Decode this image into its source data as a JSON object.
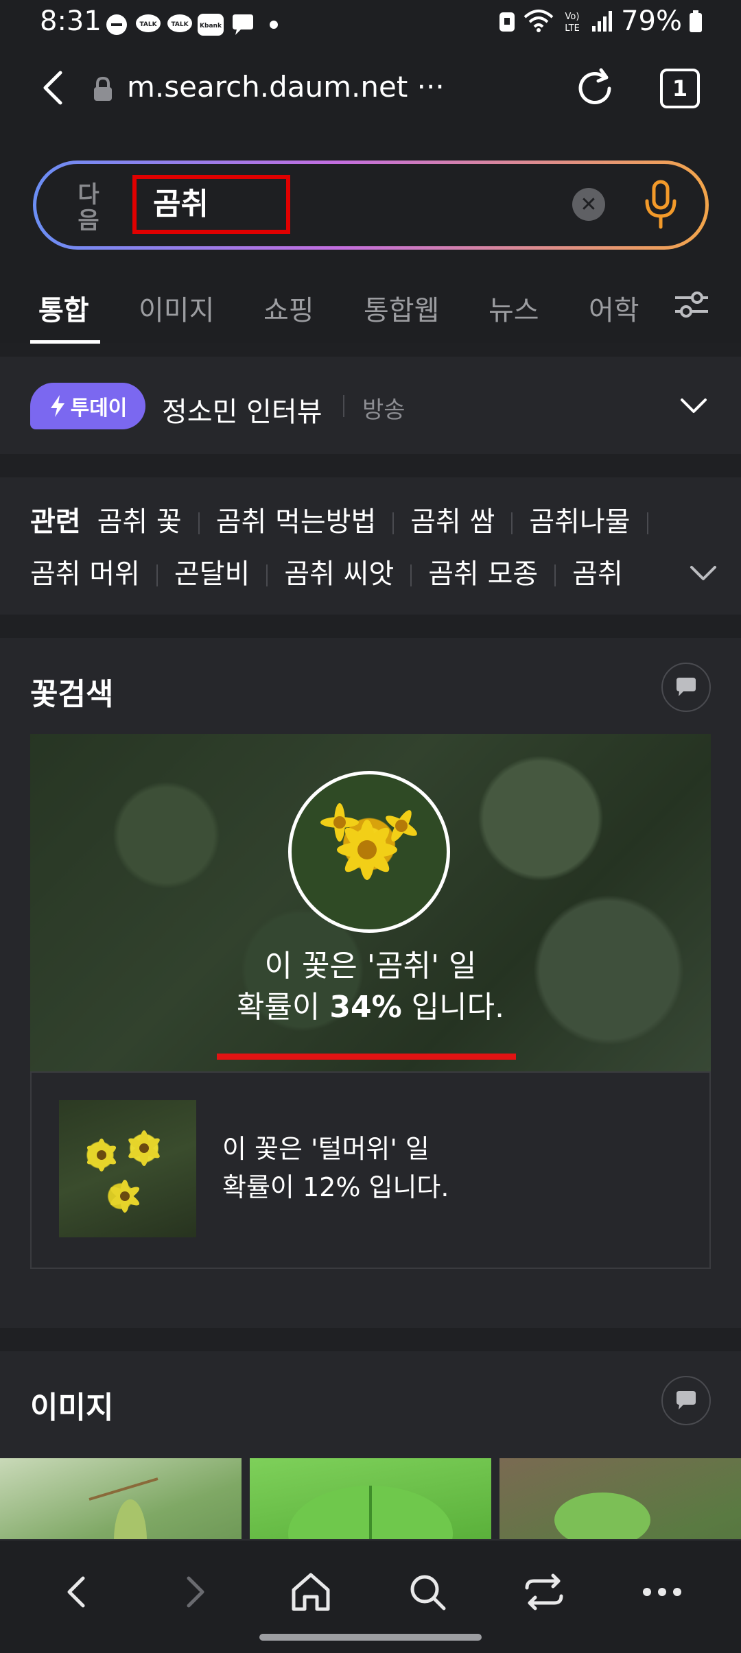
{
  "status_bar": {
    "time": "8:31",
    "notification_icons": [
      "do-not-disturb-icon",
      "kakaotalk-icon",
      "kakaotalk-icon",
      "kbank-icon",
      "chat-bubble-icon",
      "dot-icon"
    ],
    "battery": "79%"
  },
  "url_bar": {
    "url": "m.search.daum.net ···",
    "tab_count": "1"
  },
  "search": {
    "logo_text": "다음",
    "query": "곰취"
  },
  "tabs": [
    "통합",
    "이미지",
    "쇼핑",
    "통합웹",
    "뉴스",
    "어학"
  ],
  "today": {
    "badge": "투데이",
    "title": "정소민 인터뷰",
    "category": "방송"
  },
  "related": {
    "label": "관련",
    "row1": [
      "곰취 꽃",
      "곰취 먹는방법",
      "곰취 쌈",
      "곰취나물"
    ],
    "row2": [
      "곰취 머위",
      "곤달비",
      "곰취 씨앗",
      "곰취 모종",
      "곰취"
    ]
  },
  "flower_search": {
    "title": "꽃검색",
    "result_line1": "이 꽃은 '곰취' 일",
    "result_prefix": "확률이 ",
    "result_percent": "34%",
    "result_suffix": " 입니다.",
    "alt_line1": "이 꽃은 '털머위' 일",
    "alt_line2": "확률이 12% 입니다."
  },
  "images_section": {
    "title": "이미지"
  },
  "colors": {
    "background": "#1f2023",
    "panel": "#26272b",
    "highlight_red": "#e00000",
    "today_badge": "#7b68f0"
  },
  "bottom_nav": [
    "back-icon",
    "forward-icon",
    "home-icon",
    "search-icon",
    "tabs-switch-icon",
    "more-icon"
  ]
}
